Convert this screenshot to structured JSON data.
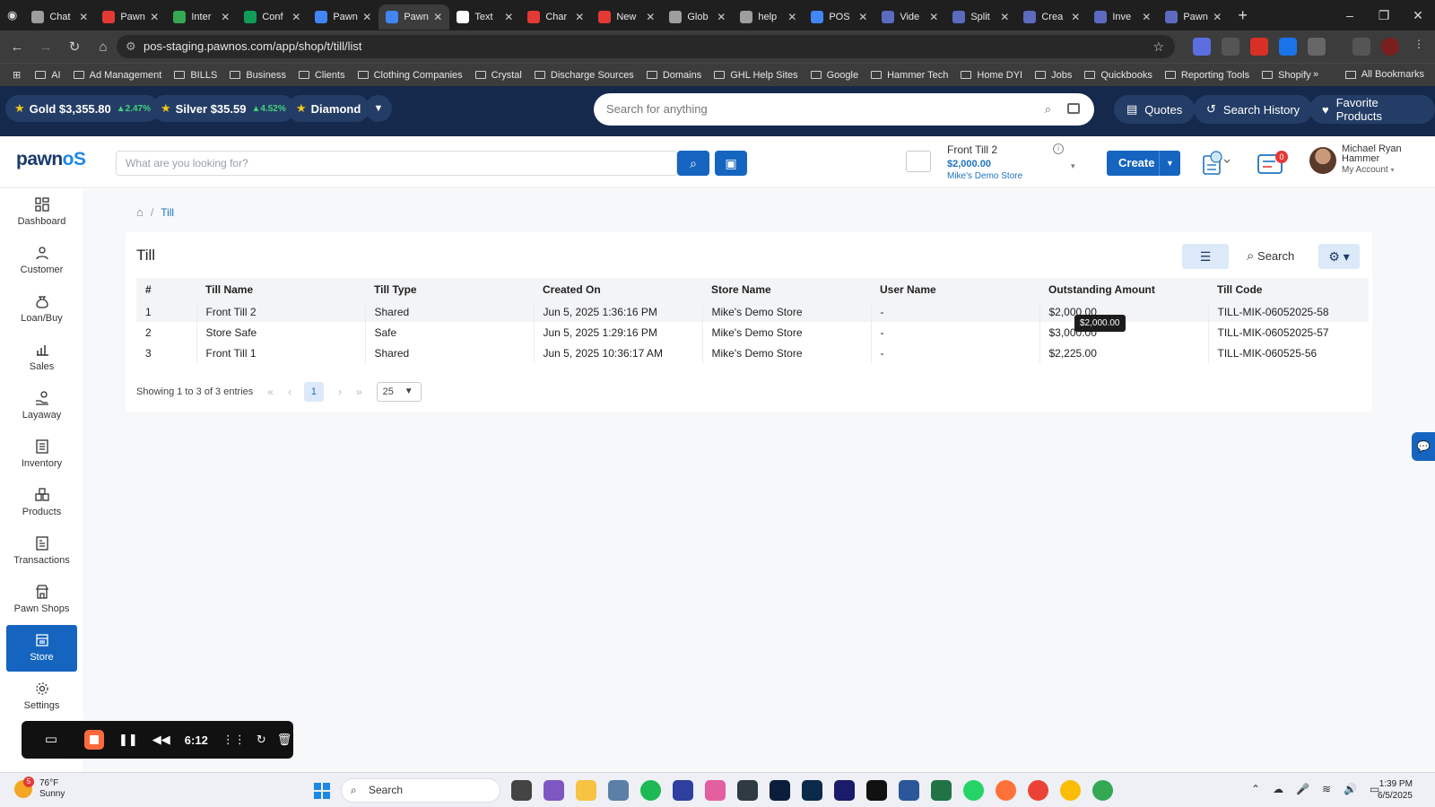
{
  "browser": {
    "tabs": [
      {
        "label": "Chat",
        "color": "#9e9e9e"
      },
      {
        "label": "Pawn",
        "color": "#e53935"
      },
      {
        "label": "Inter",
        "color": "#34a853"
      },
      {
        "label": "Conf",
        "color": "#0f9d58"
      },
      {
        "label": "Pawn",
        "color": "#4285f4"
      },
      {
        "label": "Pawn",
        "color": "#4285f4",
        "active": true
      },
      {
        "label": "Text",
        "color": "#ffffff"
      },
      {
        "label": "Char",
        "color": "#e53935"
      },
      {
        "label": "New",
        "color": "#e53935"
      },
      {
        "label": "Glob",
        "color": "#9e9e9e"
      },
      {
        "label": "help",
        "color": "#9e9e9e"
      },
      {
        "label": "POS",
        "color": "#4285f4"
      },
      {
        "label": "Vide",
        "color": "#5c6bc0"
      },
      {
        "label": "Split",
        "color": "#5c6bc0"
      },
      {
        "label": "Crea",
        "color": "#5c6bc0"
      },
      {
        "label": "Inve",
        "color": "#5c6bc0"
      },
      {
        "label": "Pawn",
        "color": "#5c6bc0"
      }
    ],
    "url": "pos-staging.pawnos.com/app/shop/t/till/list",
    "bookmarks": [
      "AI",
      "Ad Management",
      "BILLS",
      "Business",
      "Clients",
      "Clothing Companies",
      "Crystal",
      "Discharge Sources",
      "Domains",
      "GHL Help Sites",
      "Google",
      "Hammer Tech",
      "Home DYI",
      "Jobs",
      "Quickbooks",
      "Reporting Tools",
      "Shopify"
    ],
    "all_bookmarks": "All Bookmarks"
  },
  "ticker": {
    "gold": {
      "label": "Gold",
      "price": "$3,355.80",
      "change": "▲2.47%"
    },
    "silver": {
      "label": "Silver",
      "price": "$35.59",
      "change": "▲4.52%"
    },
    "diamond": {
      "label": "Diamond"
    },
    "search_placeholder": "Search for anything",
    "quotes": "Quotes",
    "search_history": "Search History",
    "favorite_products": "Favorite Products"
  },
  "header": {
    "logo_a": "pawn",
    "logo_b": "oS",
    "search_placeholder": "What are you looking for?",
    "till_name": "Front Till 2",
    "till_amount": "$2,000.00",
    "till_store": "Mike's Demo Store",
    "create": "Create",
    "notif_count": "0",
    "user_name_1": "Michael Ryan",
    "user_name_2": "Hammer",
    "my_account": "My Account"
  },
  "sidebar": {
    "items": [
      {
        "label": "Dashboard"
      },
      {
        "label": "Customer"
      },
      {
        "label": "Loan/Buy"
      },
      {
        "label": "Sales"
      },
      {
        "label": "Layaway"
      },
      {
        "label": "Inventory"
      },
      {
        "label": "Products"
      },
      {
        "label": "Transactions"
      },
      {
        "label": "Pawn Shops"
      },
      {
        "label": "Store",
        "active": true
      },
      {
        "label": "Settings"
      }
    ]
  },
  "main": {
    "breadcrumb": "Till",
    "title": "Till",
    "search_label": "Search",
    "columns": [
      "#",
      "Till Name",
      "Till Type",
      "Created On",
      "Store Name",
      "User Name",
      "Outstanding Amount",
      "Till Code"
    ],
    "rows": [
      [
        "1",
        "Front Till 2",
        "Shared",
        "Jun 5, 2025 1:36:16 PM",
        "Mike's Demo Store",
        "-",
        "$2,000.00",
        "TILL-MIK-06052025-58"
      ],
      [
        "2",
        "Store Safe",
        "Safe",
        "Jun 5, 2025 1:29:16 PM",
        "Mike's Demo Store",
        "-",
        "$3,000.00",
        "TILL-MIK-06052025-57"
      ],
      [
        "3",
        "Front Till 1",
        "Shared",
        "Jun 5, 2025 10:36:17 AM",
        "Mike's Demo Store",
        "-",
        "$2,225.00",
        "TILL-MIK-060525-56"
      ]
    ],
    "tooltip": "$2,000.00",
    "entries_info": "Showing 1 to 3 of 3 entries",
    "current_page": "1",
    "page_size": "25"
  },
  "recorder": {
    "time": "6:12"
  },
  "taskbar": {
    "temp": "76°F",
    "condition": "Sunny",
    "weather_badge": "5",
    "search": "Search",
    "time": "1:39 PM",
    "date": "6/5/2025"
  }
}
